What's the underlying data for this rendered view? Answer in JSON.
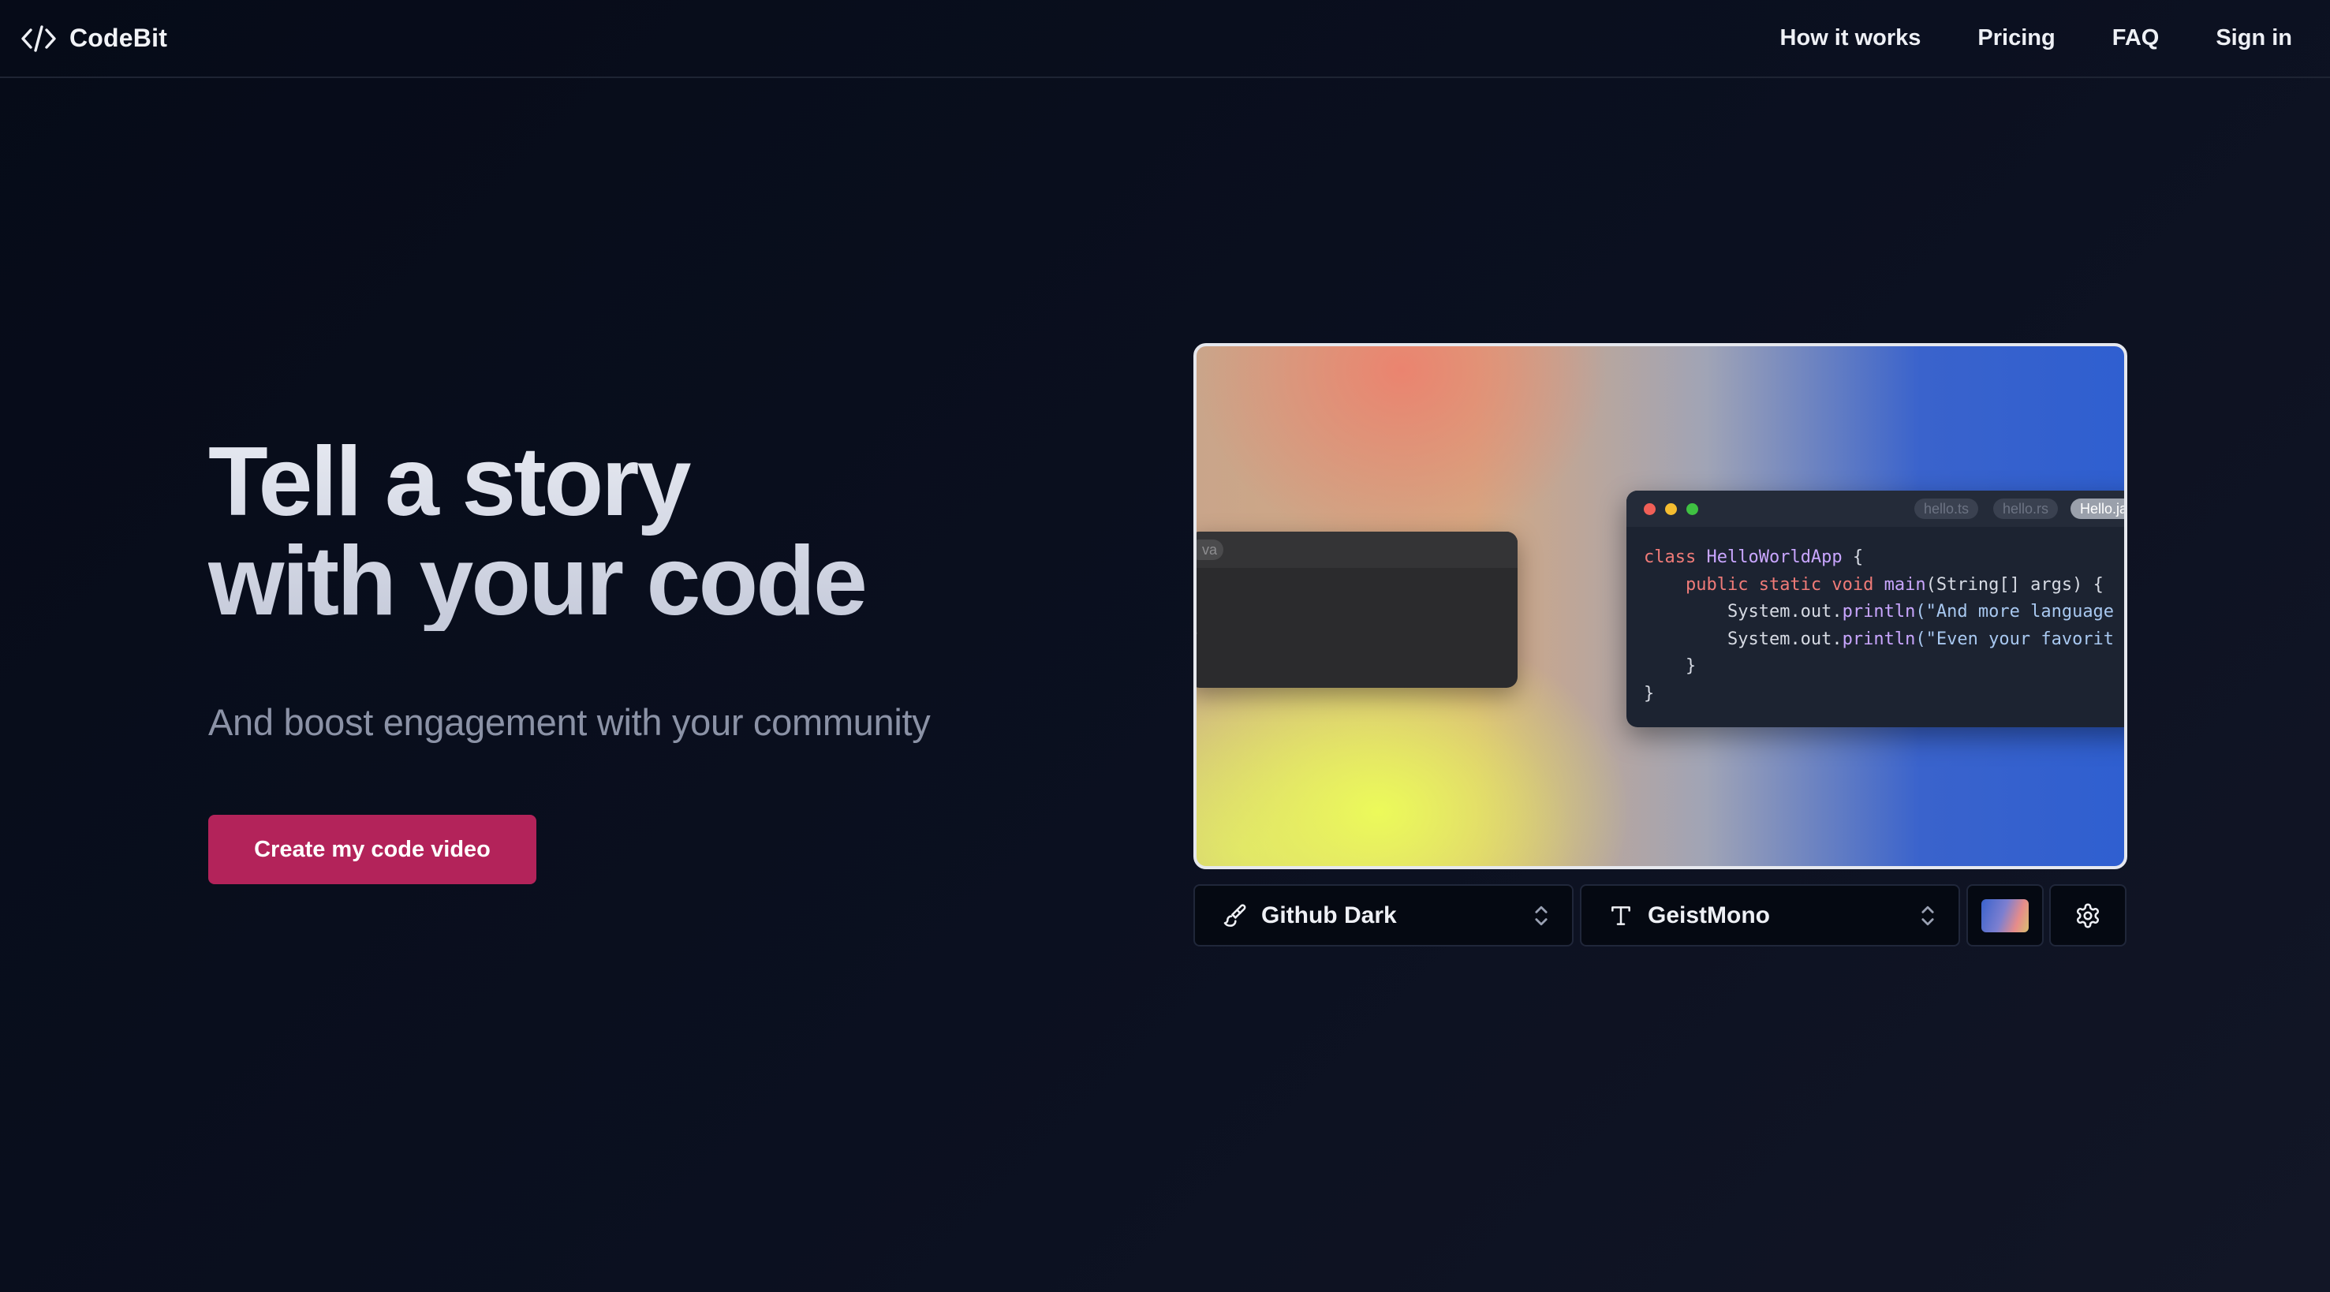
{
  "brand": {
    "name": "CodeBit",
    "icon": "code-brackets-icon"
  },
  "nav": {
    "links": [
      {
        "label": "How it works"
      },
      {
        "label": "Pricing"
      },
      {
        "label": "FAQ"
      },
      {
        "label": "Sign in"
      }
    ]
  },
  "hero": {
    "title_line1": "Tell a story",
    "title_line2": "with your code",
    "subtitle": "And boost engagement with your community",
    "cta_label": "Create my code video"
  },
  "preview": {
    "left_window": {
      "tab": "va",
      "fragment": ";"
    },
    "right_window": {
      "tabs": [
        "hello.ts",
        "hello.rs",
        "Hello.ja"
      ],
      "active_tab": 2,
      "code": {
        "l1_kw": "class",
        "l1_cls": "HelloWorldApp",
        "l1_end": " {",
        "l2_kw": "public static void",
        "l2_fn": "main",
        "l2_end": "(String[] args) {",
        "l3_obj": "System.out.",
        "l3_fn": "println",
        "l3_str": "(\"And more language",
        "l4_obj": "System.out.",
        "l4_fn": "println",
        "l4_str": "(\"Even your favorit",
        "l5": "}",
        "l6": "}"
      }
    }
  },
  "controls": {
    "theme": {
      "label": "Github Dark",
      "icon": "paintbrush-icon"
    },
    "font": {
      "label": "GeistMono",
      "icon": "type-icon"
    },
    "background_icon": "gradient-swatch",
    "settings_icon": "gear-icon"
  },
  "colors": {
    "background": "#0b1020",
    "cta": "#b3235a",
    "code_keyword": "#f07b78",
    "code_class": "#c9a6ff",
    "code_string": "#a8c8f0"
  }
}
